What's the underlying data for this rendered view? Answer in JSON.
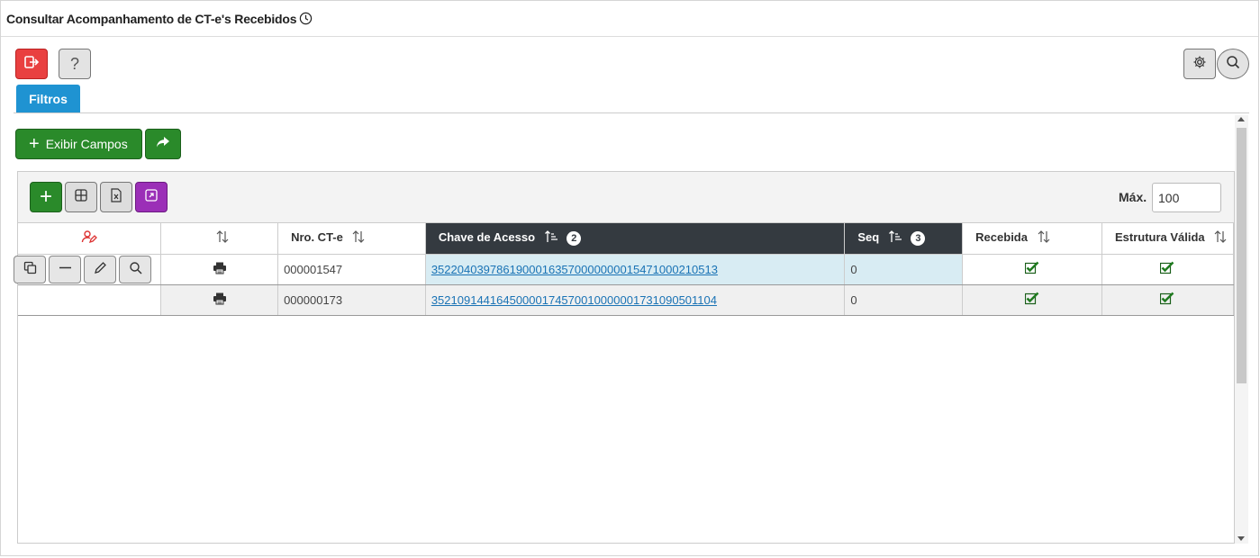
{
  "header": {
    "title": "Consultar Acompanhamento de CT-e's Recebidos",
    "title_icon": "clock-icon"
  },
  "toolbar": {
    "exit_icon": "exit-icon",
    "help_label": "?",
    "settings_icon": "gear-icon",
    "search_icon": "search-icon"
  },
  "tabs": {
    "filtros_label": "Filtros"
  },
  "actions": {
    "exibir_campos_label": "Exibir Campos",
    "share_icon": "share-arrow-icon"
  },
  "grid_toolbar": {
    "max_label": "Máx.",
    "max_value": "100"
  },
  "table": {
    "columns": [
      {
        "label": "",
        "icon": "user-edit-icon"
      },
      {
        "label": "",
        "sort": "both"
      },
      {
        "label": "Nro. CT-e",
        "sort": "both"
      },
      {
        "label": "Chave de Acesso",
        "sort": "asc",
        "order": "2"
      },
      {
        "label": "Seq",
        "sort": "asc",
        "order": "3"
      },
      {
        "label": "Recebida",
        "sort": "both"
      },
      {
        "label": "Estrutura Válida",
        "sort": "both"
      }
    ],
    "rows": [
      {
        "nro": "000001547",
        "chave": "35220403978619000163570000000015471000210513",
        "seq": "0",
        "recebida": true,
        "estrutura_valida": true
      },
      {
        "nro": "000000173",
        "chave": "35210914416450000174570010000001731090501104",
        "seq": "0",
        "recebida": true,
        "estrutura_valida": true
      }
    ]
  },
  "colors": {
    "accent_blue": "#1f93d2",
    "green": "#2a8a2a",
    "red": "#e94040",
    "purple": "#9b2fb7",
    "dark_header": "#343a40",
    "selected_row": "#d8ecf3"
  }
}
